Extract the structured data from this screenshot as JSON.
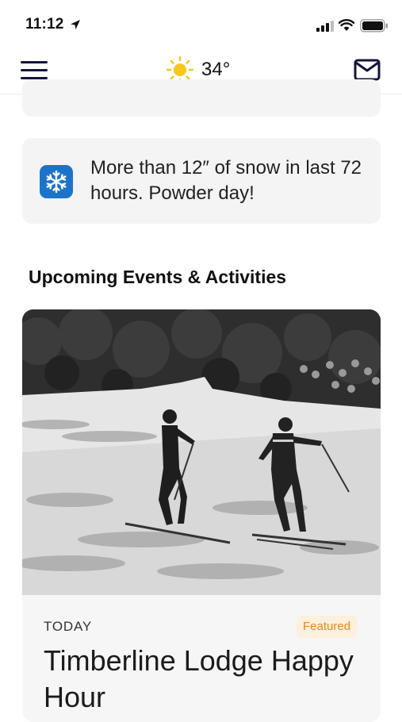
{
  "status_bar": {
    "time": "11:12"
  },
  "header": {
    "temperature": "34°",
    "weather_icon": "sun-icon",
    "menu_icon": "hamburger-menu-icon",
    "mail_icon": "envelope-icon"
  },
  "alert": {
    "icon": "snowflake-icon",
    "text": "More than 12″ of snow in last 72 hours. Powder day!",
    "icon_color": "#1d73c9"
  },
  "section": {
    "title": "Upcoming Events & Activities"
  },
  "event": {
    "date_label": "TODAY",
    "badge": "Featured",
    "title": "Timberline Lodge Happy Hour"
  },
  "colors": {
    "card_background": "#f4f4f4",
    "badge_text": "#e08a1e",
    "badge_background": "#fdf0dc",
    "nav_icon": "#14153a"
  }
}
